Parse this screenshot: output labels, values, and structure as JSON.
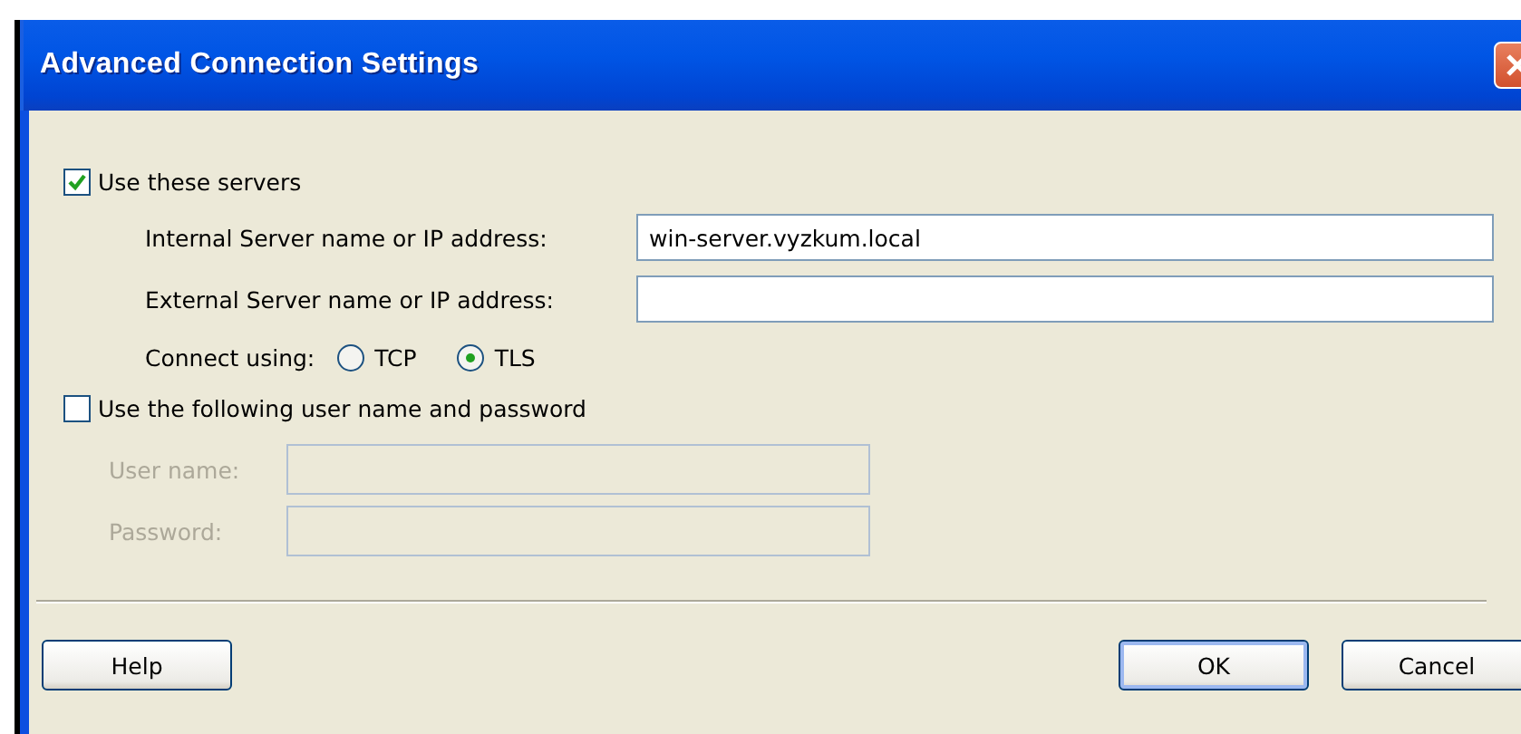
{
  "window": {
    "title": "Advanced Connection Settings"
  },
  "servers_checkbox": {
    "label": "Use these servers",
    "checked": true
  },
  "server_fields": [
    {
      "label": "Internal Server name or IP address:",
      "value": "win-server.vyzkum.local"
    },
    {
      "label": "External Server name or IP address:"
    }
  ],
  "connect_using": {
    "label": "Connect using:",
    "options": [
      {
        "label": "TCP",
        "selected": false
      },
      {
        "label": "TLS",
        "selected": true
      }
    ]
  },
  "credentials_checkbox": {
    "label": "Use the following user name and password",
    "checked": false
  },
  "credential_fields": [
    {
      "label": "User name:",
      "disabled": true
    },
    {
      "label": "Password:",
      "disabled": true
    }
  ],
  "buttons": [
    {
      "label": "Help",
      "kind": "left"
    },
    {
      "label": "OK",
      "kind": "default"
    },
    {
      "label": "Cancel",
      "kind": "right"
    }
  ]
}
